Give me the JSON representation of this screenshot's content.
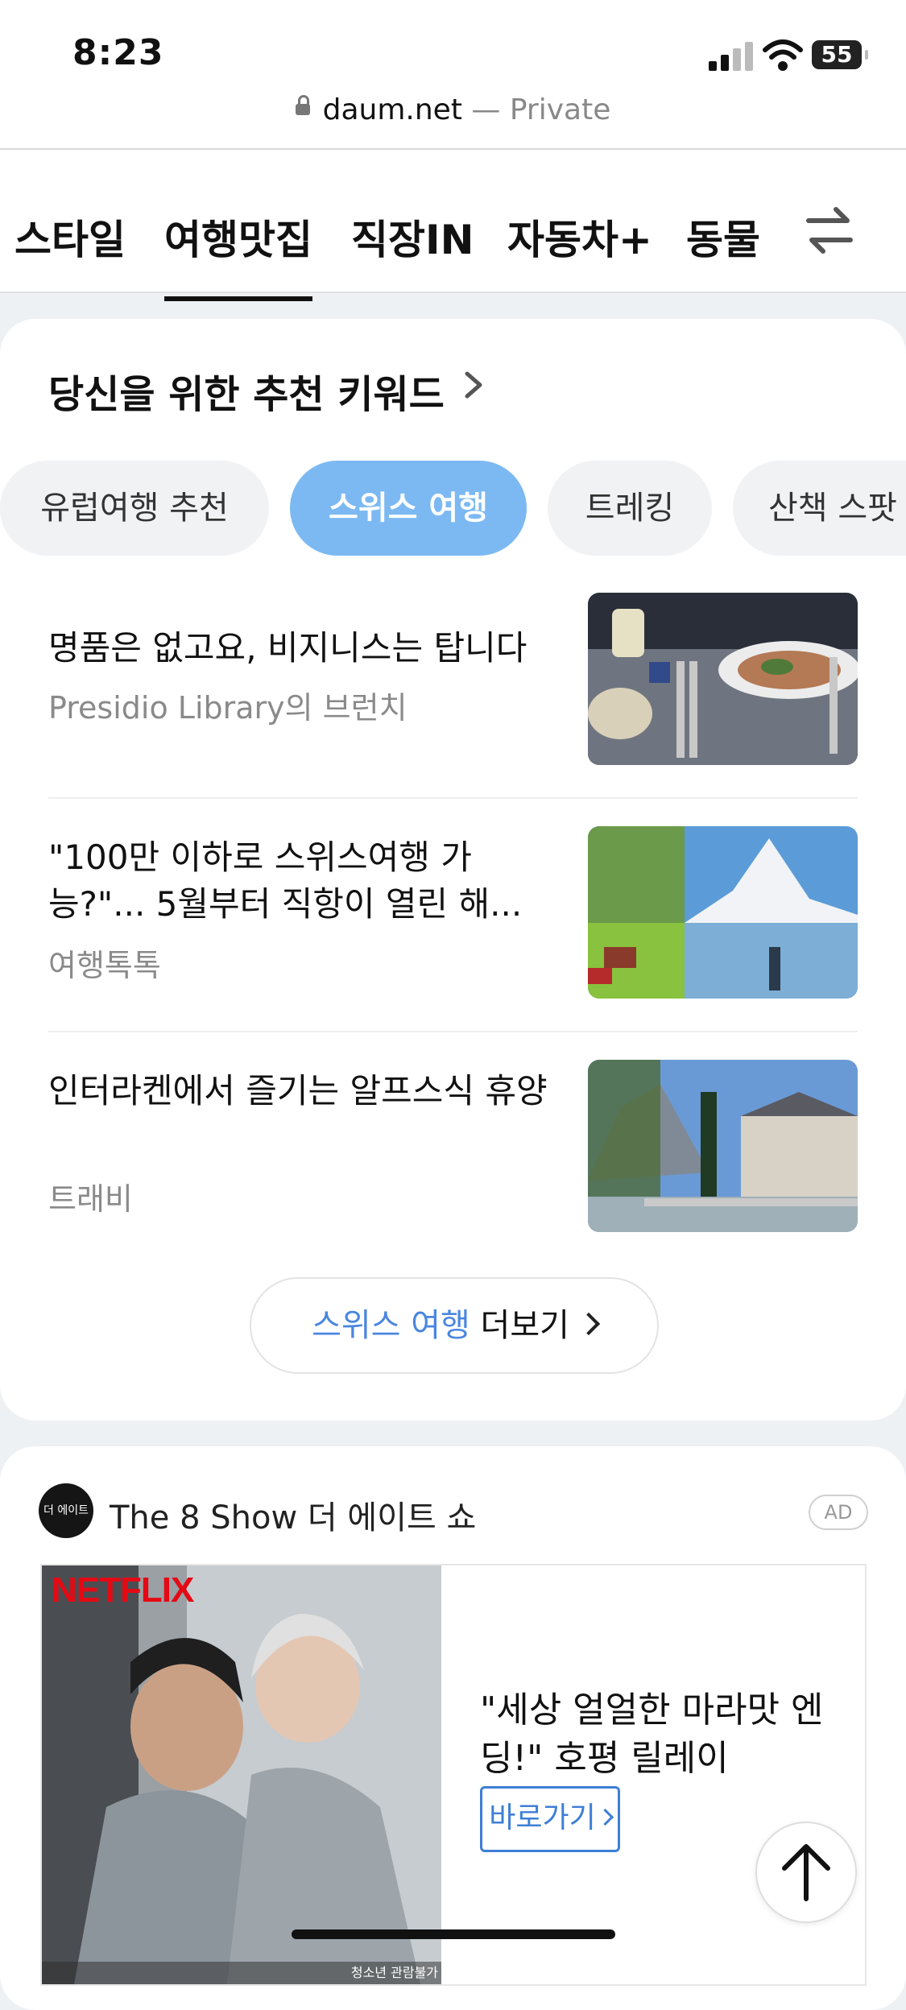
{
  "status": {
    "time": "8:23",
    "battery": "55"
  },
  "browser": {
    "domain": "daum.net",
    "mode": "— Private"
  },
  "categories": [
    {
      "label": "스타일",
      "active": false
    },
    {
      "label": "여행맛집",
      "active": true
    },
    {
      "label": "직장IN",
      "active": false
    },
    {
      "label": "자동차+",
      "active": false
    },
    {
      "label": "동물",
      "active": false
    }
  ],
  "keywords": {
    "title": "당신을 위한 추천 키워드",
    "chips": [
      {
        "label": "유럽여행 추천",
        "active": false
      },
      {
        "label": "스위스 여행",
        "active": true
      },
      {
        "label": "트레킹",
        "active": false
      },
      {
        "label": "산책 스팟",
        "active": false
      }
    ],
    "items": [
      {
        "title": "명품은 없고요, 비지니스는 탑니다",
        "source": "Presidio Library의 브런치"
      },
      {
        "title": "\"100만 이하로 스위스여행 가능?\"... 5월부터 직항이 열린 해...",
        "source": "여행톡톡"
      },
      {
        "title": "인터라켄에서 즐기는 알프스식 휴양",
        "source": "트래비"
      }
    ],
    "more": {
      "keyword": "스위스 여행",
      "label": "더보기"
    }
  },
  "ad": {
    "logo_text": "더 에이트 쇼",
    "name": "The 8 Show 더 에이트 쇼",
    "badge": "AD",
    "brand": "NETFLIX",
    "rating": "청소년 관람불가",
    "headline": "\"세상 얼얼한 마라맛 엔딩!\" 호평 릴레이",
    "cta": "바로가기"
  },
  "colors": {
    "accent_chip": "#7cb9f2",
    "link_blue": "#4a86e0",
    "cta_blue": "#3d7fd6"
  }
}
